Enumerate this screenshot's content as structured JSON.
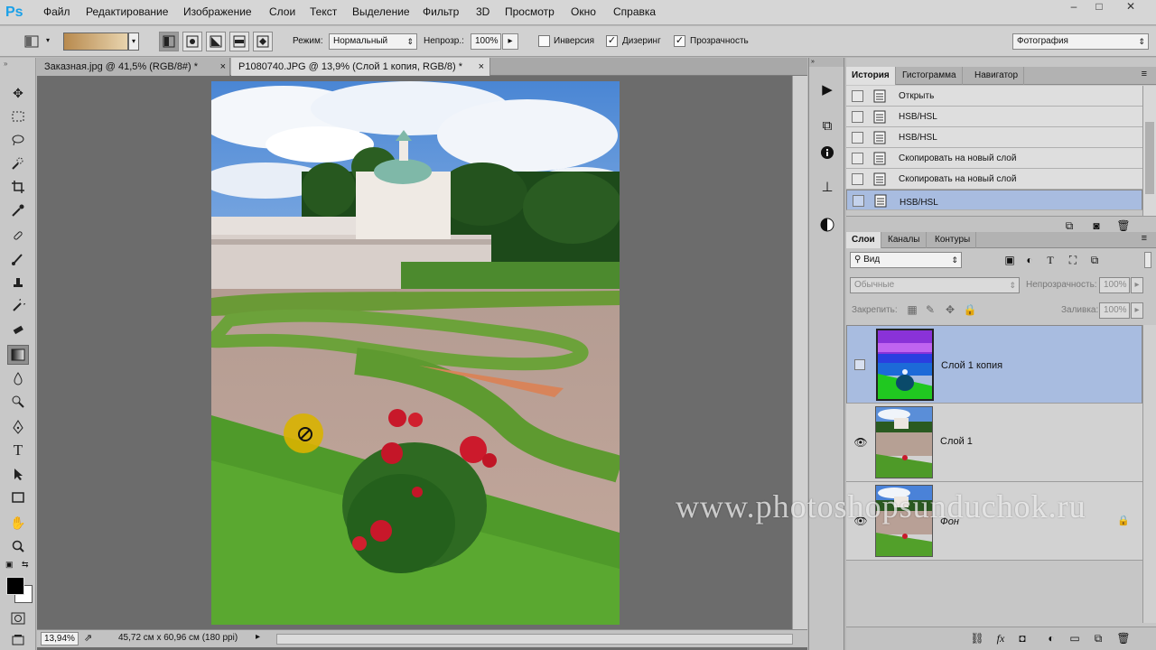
{
  "app": {
    "logo": "Ps"
  },
  "menu": [
    "Файл",
    "Редактирование",
    "Изображение",
    "Слои",
    "Текст",
    "Выделение",
    "Фильтр",
    "3D",
    "Просмотр",
    "Окно",
    "Справка"
  ],
  "window_buttons": [
    "–",
    "□",
    "✕"
  ],
  "options": {
    "mode_label": "Режим:",
    "mode_value": "Нормальный",
    "opacity_label": "Непрозр.:",
    "opacity_value": "100%",
    "reverse_label": "Инверсия",
    "dither_label": "Дизеринг",
    "transparency_label": "Прозрачность",
    "workspace_value": "Фотография",
    "gradient_colors": [
      "#b88a4e",
      "#e8d4ae"
    ]
  },
  "doc_tabs": [
    {
      "label": "Заказная.jpg @ 41,5% (RGB/8#) *",
      "close": "×"
    },
    {
      "label": "P1080740.JPG @ 13,9% (Слой 1 копия, RGB/8) *",
      "close": "×"
    }
  ],
  "status": {
    "zoom": "13,94%",
    "doc_size": "45,72 см x 60,96 см (180 ppi)"
  },
  "history_panel": {
    "tabs": [
      "История",
      "Гистограмма",
      "Навигатор"
    ],
    "items": [
      "Открыть",
      "HSB/HSL",
      "HSB/HSL",
      "Скопировать на новый слой",
      "Скопировать на новый слой",
      "HSB/HSL"
    ]
  },
  "layers_panel": {
    "tabs": [
      "Слои",
      "Каналы",
      "Контуры"
    ],
    "filter_value": "Вид",
    "blend_value": "Обычные",
    "opacity_label": "Непрозрачность:",
    "opacity_value": "100%",
    "lock_label": "Закрепить:",
    "fill_label": "Заливка:",
    "fill_value": "100%",
    "layers": [
      {
        "name": "Слой 1 копия",
        "visible": false
      },
      {
        "name": "Слой 1",
        "visible": true
      },
      {
        "name": "Фон",
        "visible": true
      }
    ]
  },
  "watermark": "www.photoshopsunduchok.ru"
}
